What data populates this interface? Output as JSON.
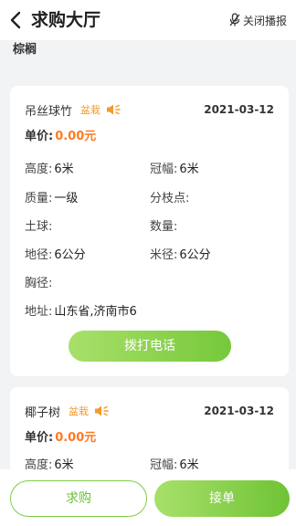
{
  "header": {
    "title": "求购大厅",
    "mute_label": "关闭播报"
  },
  "category": "棕榈",
  "colors": {
    "accent_green": "#76c83a",
    "price_orange": "#ff7a1f",
    "tag_orange": "#f39a2b"
  },
  "cards": [
    {
      "name": "吊丝球竹",
      "type": "盆栽",
      "date": "2021-03-12",
      "price_label": "单价:",
      "price": "0.00元",
      "height_label": "高度:",
      "height": "6米",
      "crown_label": "冠幅:",
      "crown": "6米",
      "quality_label": "质量:",
      "quality": "一级",
      "branch_label": "分枝点:",
      "branch": "",
      "soil_label": "土球:",
      "soil": "",
      "quantity_label": "数量:",
      "quantity": "",
      "ground_diameter_label": "地径:",
      "ground_diameter": "6公分",
      "meter_diameter_label": "米径:",
      "meter_diameter": "6公分",
      "chest_diameter_label": "胸径:",
      "chest_diameter": "",
      "address_label": "地址:",
      "address": "山东省,济南市6",
      "call_label": "拨打电话"
    },
    {
      "name": "椰子树",
      "type": "盆栽",
      "date": "2021-03-12",
      "price_label": "单价:",
      "price": "0.00元",
      "height_label": "高度:",
      "height": "6米",
      "crown_label": "冠幅:",
      "crown": "6米"
    }
  ],
  "bottom": {
    "buy_label": "求购",
    "accept_label": "接单"
  }
}
